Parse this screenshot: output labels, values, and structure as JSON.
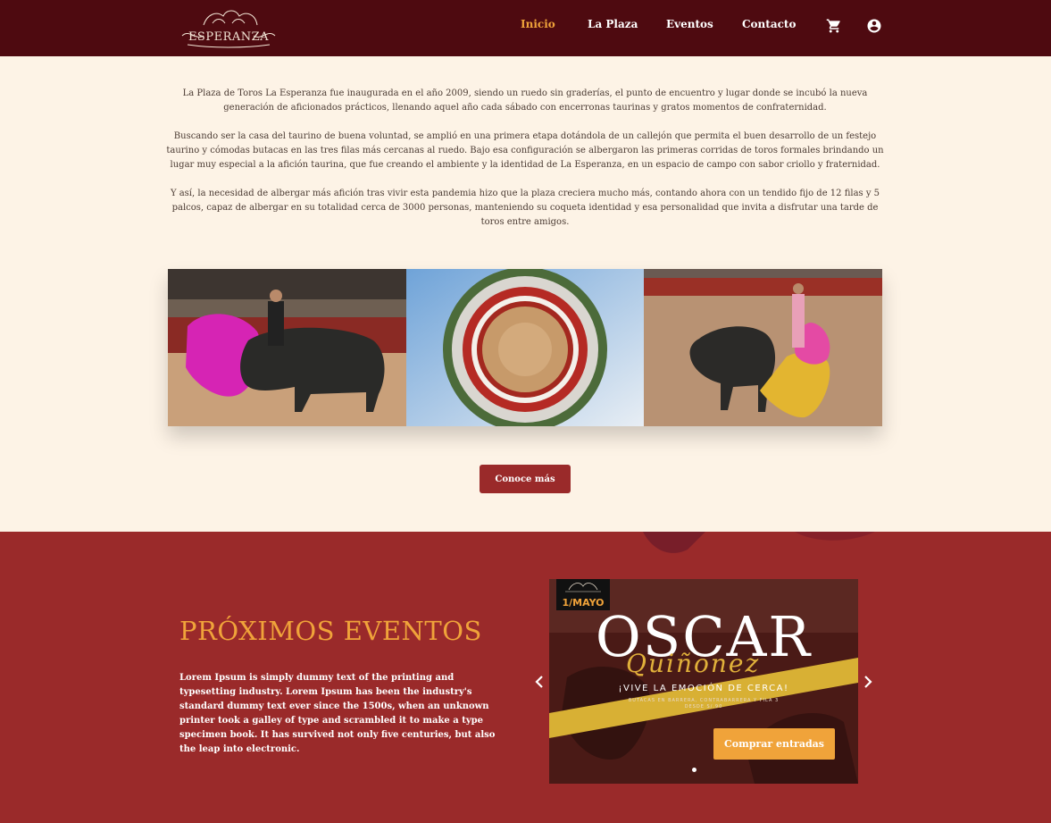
{
  "header": {
    "logo_text": "ESPERANZA",
    "nav": [
      {
        "label": "Inicio",
        "active": true
      },
      {
        "label": "La Plaza",
        "active": false
      },
      {
        "label": "Eventos",
        "active": false
      },
      {
        "label": "Contacto",
        "active": false
      }
    ],
    "icons": [
      "cart-icon",
      "account-circle-icon"
    ]
  },
  "intro": {
    "paragraphs": [
      "La Plaza de Toros La Esperanza fue inaugurada en el año 2009, siendo un ruedo sin graderías, el punto de encuentro y lugar donde se incubó la nueva generación de aficionados prácticos, llenando aquel año cada sábado con encerronas taurinas y gratos momentos de confraternidad.",
      "Buscando ser la casa del taurino de buena voluntad, se amplió en una primera etapa dotándola de un callejón que permita el buen desarrollo de un festejo taurino y cómodas butacas en las tres filas más cercanas al ruedo. Bajo esa configuración se albergaron las primeras corridas de toros formales brindando un lugar muy especial a la afición taurina, que fue creando el ambiente y la identidad de La Esperanza, en un espacio de campo con sabor criollo y fraternidad.",
      "Y así, la necesidad de albergar más afición tras vivir esta pandemia hizo que la plaza creciera mucho más, contando ahora con un tendido fijo de 12 filas y 5 palcos, capaz de albergar en su totalidad cerca de 3000 personas, manteniendo su coqueta identidad y esa personalidad que invita a disfrutar una tarde de toros entre amigos."
    ],
    "more_button": "Conoce más"
  },
  "events": {
    "title": "PRÓXIMOS EVENTOS",
    "text": "Lorem Ipsum is simply dummy text of the printing and typesetting industry. Lorem Ipsum has been the industry's standard dummy text ever since the 1500s, when an unknown printer took a galley of type and scrambled it to make a type specimen book. It has survived not only five centuries, but also the leap into electronic.",
    "poster": {
      "date": "1/MAYO",
      "name": "OSCAR",
      "script_name": "Quiñonez",
      "tagline": "¡VIVE LA EMOCIÓN DE CERCA!",
      "sub_line1": "BUTACAS EN BARRERA, CONTRABARRERA Y FILA 3",
      "sub_line2": "DESDE S/.90",
      "buy_button": "Comprar entradas"
    },
    "carousel_dots": 1
  },
  "colors": {
    "header_bg": "#4e0a10",
    "page_bg": "#fdf3e6",
    "accent": "#f0a33a",
    "events_bg": "#9a2a2a"
  }
}
